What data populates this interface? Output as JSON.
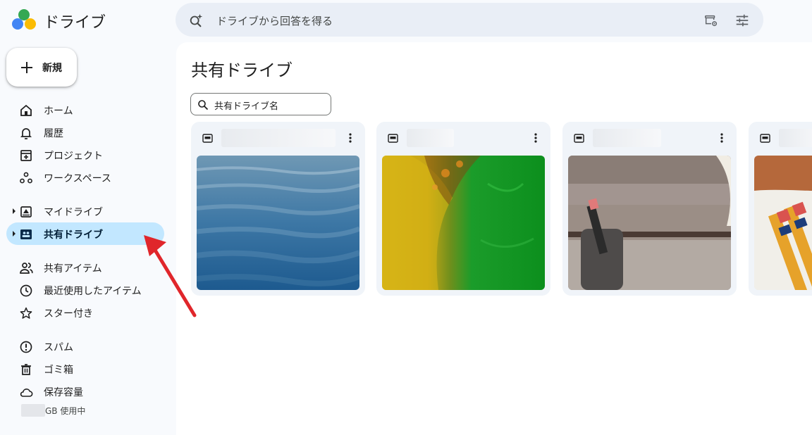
{
  "app": {
    "title": "ドライブ"
  },
  "search": {
    "placeholder": "ドライブから回答を得る",
    "icons": [
      "sparkle-search-icon",
      "drive-settings-filter-icon",
      "search-options-icon"
    ]
  },
  "new_button": {
    "label": "新規"
  },
  "nav": {
    "group1": [
      {
        "label": "ホーム",
        "icon": "home-icon"
      },
      {
        "label": "履歴",
        "icon": "bell-icon"
      },
      {
        "label": "プロジェクト",
        "icon": "project-icon"
      },
      {
        "label": "ワークスペース",
        "icon": "workspace-icon"
      }
    ],
    "group2": [
      {
        "label": "マイドライブ",
        "icon": "my-drive-icon",
        "expandable": true
      },
      {
        "label": "共有ドライブ",
        "icon": "shared-drive-icon",
        "expandable": true,
        "active": true
      }
    ],
    "group3": [
      {
        "label": "共有アイテム",
        "icon": "shared-people-icon"
      },
      {
        "label": "最近使用したアイテム",
        "icon": "clock-icon"
      },
      {
        "label": "スター付き",
        "icon": "star-icon"
      }
    ],
    "group4": [
      {
        "label": "スパム",
        "icon": "spam-icon"
      },
      {
        "label": "ゴミ箱",
        "icon": "trash-icon"
      },
      {
        "label": "保存容量",
        "icon": "cloud-icon"
      }
    ]
  },
  "storage": {
    "text": "GB 使用中"
  },
  "main": {
    "title": "共有ドライブ",
    "filter_placeholder": "共有ドライブ名"
  },
  "colors": {
    "active_bg": "#c2e7ff",
    "search_bg": "#e9eef6",
    "annotation_arrow": "#e0262b"
  }
}
